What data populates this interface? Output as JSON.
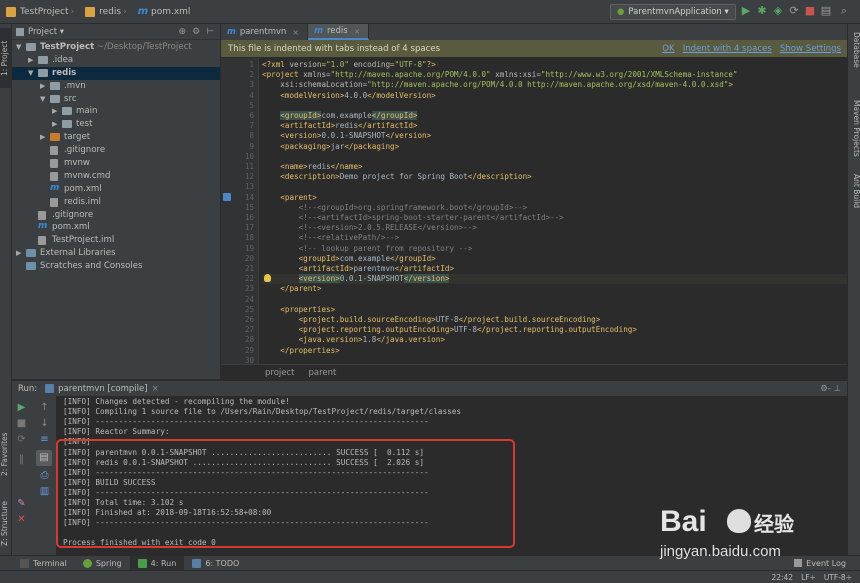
{
  "breadcrumbs": [
    "TestProject",
    "redis",
    "pom.xml"
  ],
  "toolbar": {
    "run_config": "ParentmvnApplication ▾"
  },
  "left_stripe": {
    "project": "1: Project",
    "favorites": "2: Favorites",
    "structure": "Z: Structure"
  },
  "right_stripe": {
    "database": "Database",
    "maven": "Maven Projects",
    "ant": "Ant Build"
  },
  "project_panel": {
    "title": "Project ▾",
    "items": [
      {
        "label": "TestProject",
        "suffix": " ~/Desktop/TestProject",
        "depth": 0,
        "arrow": "▼",
        "icon": "folder",
        "bold": true
      },
      {
        "label": ".idea",
        "depth": 1,
        "arrow": "▶",
        "icon": "folder"
      },
      {
        "label": "redis",
        "depth": 1,
        "arrow": "▼",
        "icon": "folder",
        "bold": true,
        "selected": true
      },
      {
        "label": ".mvn",
        "depth": 2,
        "arrow": "▶",
        "icon": "folder"
      },
      {
        "label": "src",
        "depth": 2,
        "arrow": "▼",
        "icon": "folder"
      },
      {
        "label": "main",
        "depth": 3,
        "arrow": "▶",
        "icon": "folder"
      },
      {
        "label": "test",
        "depth": 3,
        "arrow": "▶",
        "icon": "folder"
      },
      {
        "label": "target",
        "depth": 2,
        "arrow": "▶",
        "icon": "folder-orange"
      },
      {
        "label": ".gitignore",
        "depth": 2,
        "icon": "file"
      },
      {
        "label": "mvnw",
        "depth": 2,
        "icon": "file"
      },
      {
        "label": "mvnw.cmd",
        "depth": 2,
        "icon": "file"
      },
      {
        "label": "pom.xml",
        "depth": 2,
        "icon": "maven"
      },
      {
        "label": "redis.iml",
        "depth": 2,
        "icon": "file"
      },
      {
        "label": ".gitignore",
        "depth": 1,
        "icon": "file"
      },
      {
        "label": "pom.xml",
        "depth": 1,
        "icon": "maven"
      },
      {
        "label": "TestProject.iml",
        "depth": 1,
        "icon": "file"
      },
      {
        "label": "External Libraries",
        "depth": 0,
        "arrow": "▶",
        "icon": "lib"
      },
      {
        "label": "Scratches and Consoles",
        "depth": 0,
        "icon": "lib"
      }
    ]
  },
  "editor": {
    "tabs": [
      {
        "label": "parentmvn",
        "active": false
      },
      {
        "label": "redis",
        "active": true
      }
    ],
    "notice": {
      "text": "This file is indented with tabs instead of 4 spaces",
      "links": [
        "OK",
        "Indent with 4 spaces",
        "Show Settings"
      ]
    },
    "lines": [
      {
        "n": "1",
        "seg": [
          [
            "tag",
            "<?xml "
          ],
          [
            "attr",
            "version"
          ],
          [
            "tag",
            "="
          ],
          [
            "str",
            "\"1.0\""
          ],
          [
            "attr",
            " encoding"
          ],
          [
            "tag",
            "="
          ],
          [
            "str",
            "\"UTF-8\""
          ],
          [
            "tag",
            "?>"
          ]
        ]
      },
      {
        "n": "2",
        "seg": [
          [
            "tag",
            "<project "
          ],
          [
            "attr",
            "xmlns"
          ],
          [
            "txt",
            "="
          ],
          [
            "str",
            "\"http://maven.apache.org/POM/4.0.0\""
          ],
          [
            "attr",
            " xmlns:xsi"
          ],
          [
            "txt",
            "="
          ],
          [
            "str",
            "\"http://www.w3.org/2001/XMLSchema-instance\""
          ]
        ]
      },
      {
        "n": "3",
        "seg": [
          [
            "txt",
            "    "
          ],
          [
            "attr",
            "xsi:schemaLocation"
          ],
          [
            "txt",
            "="
          ],
          [
            "str",
            "\"http://maven.apache.org/POM/4.0.0 http://maven.apache.org/xsd/maven-4.0.0.xsd\""
          ],
          [
            "tag",
            ">"
          ]
        ]
      },
      {
        "n": "4",
        "seg": [
          [
            "txt",
            "    "
          ],
          [
            "tag",
            "<modelVersion>"
          ],
          [
            "txt",
            "4.0.0"
          ],
          [
            "tag",
            "</modelVersion>"
          ]
        ]
      },
      {
        "n": "5",
        "seg": []
      },
      {
        "n": "6",
        "seg": [
          [
            "txt",
            "    "
          ],
          [
            "hltag",
            "<groupId>"
          ],
          [
            "txt",
            "com.example"
          ],
          [
            "hltag",
            "</groupId>"
          ]
        ]
      },
      {
        "n": "7",
        "seg": [
          [
            "txt",
            "    "
          ],
          [
            "tag",
            "<artifactId>"
          ],
          [
            "txt",
            "redis"
          ],
          [
            "tag",
            "</artifactId>"
          ]
        ]
      },
      {
        "n": "8",
        "seg": [
          [
            "txt",
            "    "
          ],
          [
            "tag",
            "<version>"
          ],
          [
            "txt",
            "0.0.1-SNAPSHOT"
          ],
          [
            "tag",
            "</version>"
          ]
        ]
      },
      {
        "n": "9",
        "seg": [
          [
            "txt",
            "    "
          ],
          [
            "tag",
            "<packaging>"
          ],
          [
            "txt",
            "jar"
          ],
          [
            "tag",
            "</packaging>"
          ]
        ]
      },
      {
        "n": "10",
        "seg": []
      },
      {
        "n": "11",
        "seg": [
          [
            "txt",
            "    "
          ],
          [
            "tag",
            "<name>"
          ],
          [
            "txt",
            "redis"
          ],
          [
            "tag",
            "</name>"
          ]
        ]
      },
      {
        "n": "12",
        "seg": [
          [
            "txt",
            "    "
          ],
          [
            "tag",
            "<description>"
          ],
          [
            "txt",
            "Demo project for Spring Boot"
          ],
          [
            "tag",
            "</description>"
          ]
        ]
      },
      {
        "n": "13",
        "seg": []
      },
      {
        "n": "14",
        "seg": [
          [
            "txt",
            "    "
          ],
          [
            "tag",
            "<parent>"
          ]
        ]
      },
      {
        "n": "15",
        "seg": [
          [
            "cmt",
            "        <!--<groupId>org.springframework.boot</groupId>-->"
          ]
        ]
      },
      {
        "n": "16",
        "seg": [
          [
            "cmt",
            "        <!--<artifactId>spring-boot-starter-parent</artifactId>-->"
          ]
        ]
      },
      {
        "n": "17",
        "seg": [
          [
            "cmt",
            "        <!--<version>2.0.5.RELEASE</version>-->"
          ]
        ]
      },
      {
        "n": "18",
        "seg": [
          [
            "cmt",
            "        <!--<relativePath/>-->"
          ]
        ]
      },
      {
        "n": "19",
        "seg": [
          [
            "cmt",
            "        <!-- lookup parent from repository -->"
          ]
        ]
      },
      {
        "n": "20",
        "seg": [
          [
            "txt",
            "        "
          ],
          [
            "tag",
            "<groupId>"
          ],
          [
            "txt",
            "com.example"
          ],
          [
            "tag",
            "</groupId>"
          ]
        ]
      },
      {
        "n": "21",
        "seg": [
          [
            "txt",
            "        "
          ],
          [
            "tag",
            "<artifactId>"
          ],
          [
            "txt",
            "parentmvn"
          ],
          [
            "tag",
            "</artifactId>"
          ]
        ]
      },
      {
        "n": "22",
        "seg": [
          [
            "txt",
            "        "
          ],
          [
            "hltag",
            "<version>"
          ],
          [
            "txt",
            "0.0.1-SNAPSHOT"
          ],
          [
            "hltag",
            "</version>"
          ]
        ],
        "current": true
      },
      {
        "n": "23",
        "seg": [
          [
            "txt",
            "    "
          ],
          [
            "tag",
            "</parent>"
          ]
        ]
      },
      {
        "n": "24",
        "seg": []
      },
      {
        "n": "25",
        "seg": [
          [
            "txt",
            "    "
          ],
          [
            "tag",
            "<properties>"
          ]
        ]
      },
      {
        "n": "26",
        "seg": [
          [
            "txt",
            "        "
          ],
          [
            "tag",
            "<project.build.sourceEncoding>"
          ],
          [
            "txt",
            "UTF-8"
          ],
          [
            "tag",
            "</project.build.sourceEncoding>"
          ]
        ]
      },
      {
        "n": "27",
        "seg": [
          [
            "txt",
            "        "
          ],
          [
            "tag",
            "<project.reporting.outputEncoding>"
          ],
          [
            "txt",
            "UTF-8"
          ],
          [
            "tag",
            "</project.reporting.outputEncoding>"
          ]
        ]
      },
      {
        "n": "28",
        "seg": [
          [
            "txt",
            "        "
          ],
          [
            "tag",
            "<java.version>"
          ],
          [
            "txt",
            "1.8"
          ],
          [
            "tag",
            "</java.version>"
          ]
        ]
      },
      {
        "n": "29",
        "seg": [
          [
            "txt",
            "    "
          ],
          [
            "tag",
            "</properties>"
          ]
        ]
      },
      {
        "n": "30",
        "seg": []
      }
    ],
    "breadcrumb": [
      "project",
      "parent"
    ]
  },
  "run_panel": {
    "title": "Run:",
    "tab": "parentmvn [compile]",
    "settings": "⚙- ⊥",
    "lines": [
      "[INFO] Changes detected - recompiling the module!",
      "[INFO] Compiling 1 source file to /Users/Rain/Desktop/TestProject/redis/target/classes",
      "[INFO] ------------------------------------------------------------------------",
      "[INFO] Reactor Summary:",
      "[INFO]",
      "[INFO] parentmvn 0.0.1-SNAPSHOT .......................... SUCCESS [  0.112 s]",
      "[INFO] redis 0.0.1-SNAPSHOT .............................. SUCCESS [  2.026 s]",
      "[INFO] ------------------------------------------------------------------------",
      "[INFO] BUILD SUCCESS",
      "[INFO] ------------------------------------------------------------------------",
      "[INFO] Total time: 3.102 s",
      "[INFO] Finished at: 2018-09-18T16:52:58+08:00",
      "[INFO] ------------------------------------------------------------------------",
      "",
      "Process finished with exit code 0"
    ]
  },
  "bottom_tabs": [
    {
      "label": "Terminal",
      "color": "#555555"
    },
    {
      "label": "Spring",
      "color": "#6a9e3a"
    },
    {
      "label": "4: Run",
      "color": "#4a9d4a",
      "active": true
    },
    {
      "label": "6: TODO",
      "color": "#5a7fa6"
    }
  ],
  "status_bar": {
    "event_log": "Event Log",
    "position": "22:42",
    "line_sep": "LF÷",
    "encoding": "UTF-8÷"
  },
  "watermark": {
    "brand": "Bai",
    "suffix": "经验",
    "url": "jingyan.baidu.com"
  },
  "colors": {
    "accent": "#4a88c7",
    "success_box": "#d93a30",
    "notice_bg": "#595a3e"
  }
}
